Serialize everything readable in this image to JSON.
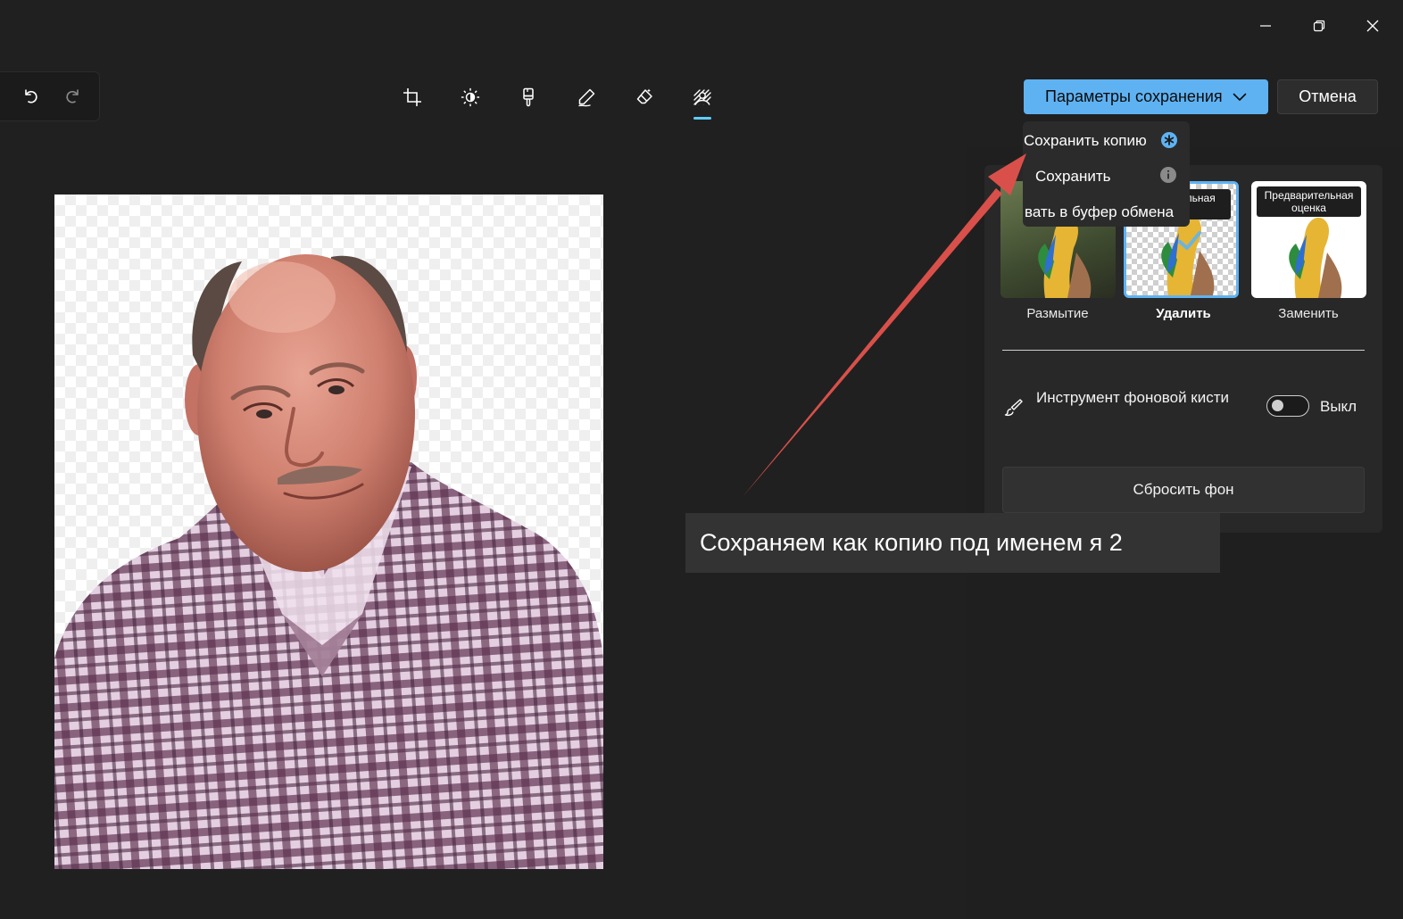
{
  "window": {
    "minimize_icon": "minimize-icon",
    "restore_icon": "restore-icon",
    "close_icon": "close-icon"
  },
  "history": {
    "undo_icon": "undo-icon",
    "redo_icon": "redo-icon"
  },
  "toolbar": {
    "tools": [
      {
        "icon": "crop-icon",
        "active": false
      },
      {
        "icon": "brightness-icon",
        "active": false
      },
      {
        "icon": "filter-brush-icon",
        "active": false
      },
      {
        "icon": "markup-pen-icon",
        "active": false
      },
      {
        "icon": "erase-icon",
        "active": false
      },
      {
        "icon": "background-icon",
        "active": true
      }
    ],
    "accent_color": "#60cdff"
  },
  "header": {
    "save_options_label": "Параметры сохранения",
    "cancel_label": "Отмена"
  },
  "save_menu": {
    "items": [
      {
        "label": "Сохранить копию",
        "icon": "asterisk-icon"
      },
      {
        "label": "Сохранить",
        "icon": "info-icon"
      },
      {
        "label": "вать в буфер обмена"
      }
    ]
  },
  "background_panel": {
    "options": [
      {
        "label": "Размытие",
        "selected": false
      },
      {
        "label": "Удалить",
        "selected": true,
        "tag": "тельная ка"
      },
      {
        "label": "Заменить",
        "selected": false,
        "tag": "Предварительная оценка"
      }
    ],
    "brush_tool_label": "Инструмент фоновой кисти",
    "brush_tool_state": "Выкл",
    "reset_label": "Сбросить фон"
  },
  "annotation": {
    "caption": "Сохраняем как копию под именем я 2",
    "arrow_color": "#d9504a"
  }
}
